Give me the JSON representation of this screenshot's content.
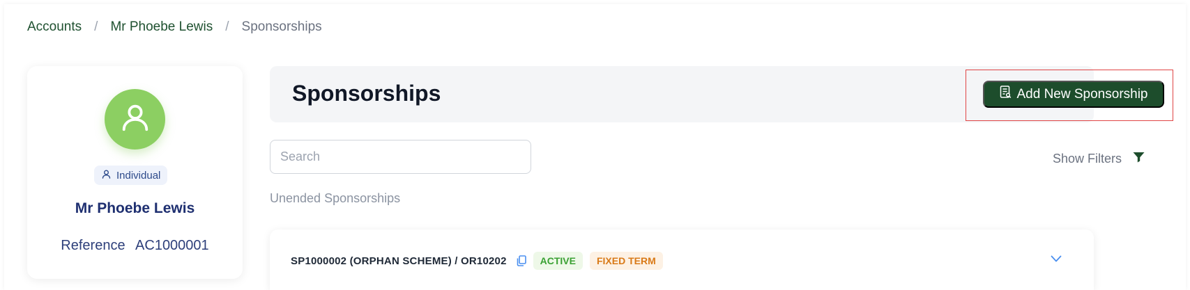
{
  "breadcrumb": {
    "items": [
      "Accounts",
      "Mr Phoebe Lewis"
    ],
    "separator": "/",
    "current": "Sponsorships"
  },
  "profile": {
    "icon": "user-icon",
    "type_icon": "user-icon",
    "type": "Individual",
    "name": "Mr Phoebe Lewis",
    "reference_label": "Reference",
    "reference_value": "AC1000001"
  },
  "header": {
    "title": "Sponsorships",
    "add_button_label": "Add New Sponsorship",
    "add_button_icon": "document-icon"
  },
  "search": {
    "placeholder": "Search",
    "value": ""
  },
  "filters": {
    "label": "Show Filters",
    "icon": "filter-icon"
  },
  "section": {
    "label": "Unended Sponsorships"
  },
  "sponsorships": [
    {
      "id": "SP1000002 (ORPHAN SCHEME) / OR10202",
      "status": "ACTIVE",
      "term": "FIXED TERM"
    }
  ],
  "colors": {
    "brand_green": "#1d4d2c",
    "avatar_green": "#8ccf62",
    "link_green": "#1f5130",
    "navy": "#1e2f70",
    "active_green": "#3aa133",
    "term_orange": "#d97a18",
    "highlight_red": "#e04444"
  }
}
